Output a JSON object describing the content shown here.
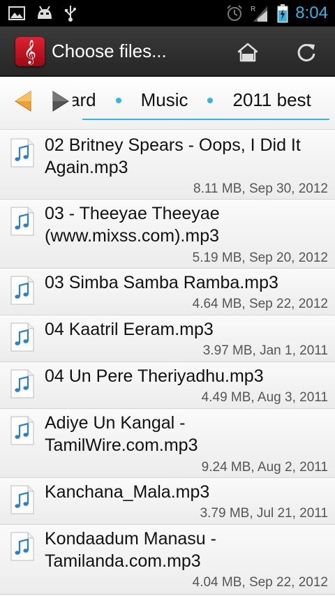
{
  "status_bar": {
    "time": "8:04",
    "left_icons": [
      "image-icon",
      "android-icon",
      "usb-icon"
    ],
    "right_icons": [
      "alarm-icon",
      "signal-icon",
      "battery-icon"
    ],
    "signal_label": "R"
  },
  "action_bar": {
    "title": "Choose files...",
    "app_icon_glyph": "𝄞",
    "actions": [
      "home-icon",
      "refresh-icon"
    ]
  },
  "breadcrumb": {
    "items": [
      "ard",
      "Music",
      "2011 best"
    ],
    "accent": "#33b5e5"
  },
  "files": [
    {
      "name": "02 Britney Spears - Oops, I Did It Again.mp3",
      "meta": "8.11 MB, Sep 30, 2012"
    },
    {
      "name": "03 - Theeyae Theeyae  (www.mixss.com).mp3",
      "meta": "5.19 MB, Sep 20, 2012"
    },
    {
      "name": "03 Simba Samba Ramba.mp3",
      "meta": "4.64 MB, Sep 22, 2012"
    },
    {
      "name": "04 Kaatril Eeram.mp3",
      "meta": "3.97 MB, Jan 1, 2011"
    },
    {
      "name": "04 Un Pere Theriyadhu.mp3",
      "meta": "4.49 MB, Aug 3, 2011"
    },
    {
      "name": "Adiye Un Kangal - TamilWire.com.mp3",
      "meta": "9.24 MB, Aug 2, 2011"
    },
    {
      "name": "Kanchana_Mala.mp3",
      "meta": "3.79 MB, Jul 21, 2011"
    },
    {
      "name": "Kondaadum Manasu - Tamilanda.com.mp3",
      "meta": "4.04 MB, Sep 22, 2012"
    }
  ]
}
